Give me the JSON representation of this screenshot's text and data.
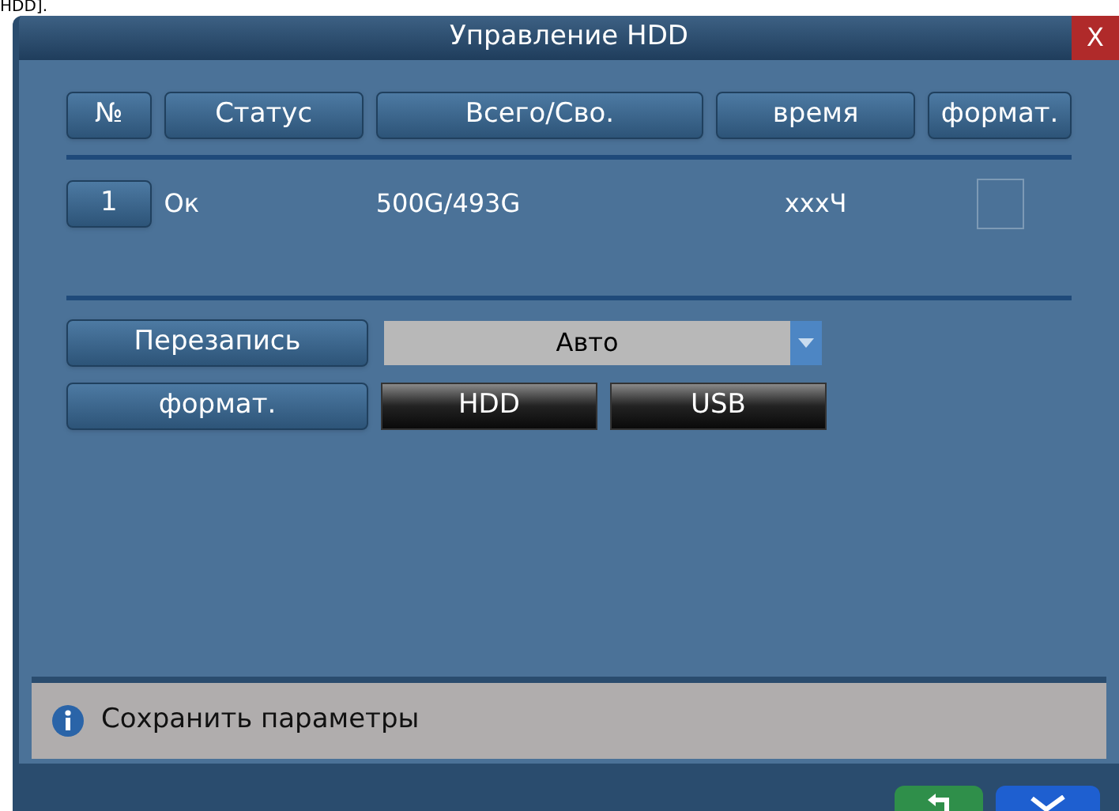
{
  "caption": "HDD].",
  "window": {
    "title": "Управление HDD"
  },
  "close": "X",
  "columns": [
    "№",
    "Статус",
    "Всего/Сво.",
    "время",
    "формат."
  ],
  "rows": [
    {
      "no": "1",
      "status": "Ок",
      "size": "500G/493G",
      "time": "xxxЧ",
      "checked": false
    }
  ],
  "overwrite": {
    "label": "Перезапись",
    "value": "Авто"
  },
  "format": {
    "label": "формат.",
    "buttons": [
      "HDD",
      "USB"
    ]
  },
  "status_bar": "Сохранить параметры"
}
